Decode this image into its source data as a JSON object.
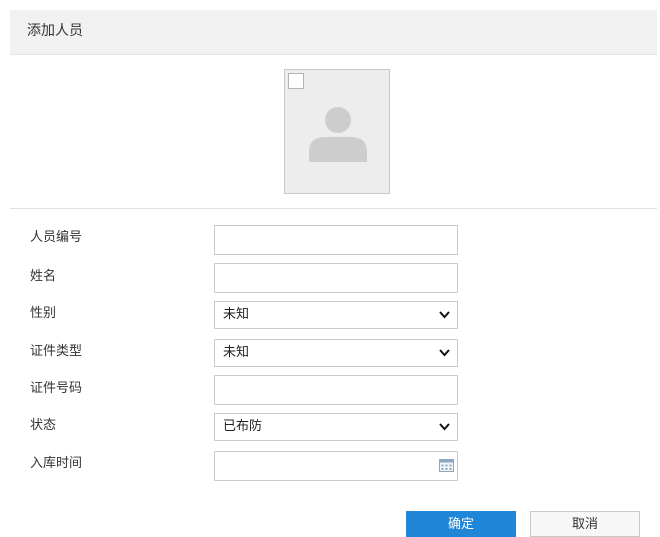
{
  "dialog": {
    "title": "添加人员"
  },
  "photo": {
    "icon": "avatar-icon"
  },
  "form": {
    "person_id_label": "人员编号",
    "person_id_value": "",
    "name_label": "姓名",
    "name_value": "",
    "gender_label": "性别",
    "gender_value": "未知",
    "id_type_label": "证件类型",
    "id_type_value": "未知",
    "id_number_label": "证件号码",
    "id_number_value": "",
    "status_label": "状态",
    "status_value": "已布防",
    "entry_time_label": "入库时间",
    "entry_time_value": ""
  },
  "buttons": {
    "confirm": "确定",
    "cancel": "取消"
  },
  "colors": {
    "primary": "#1f86d8",
    "header_bg": "#f1f1f1"
  }
}
